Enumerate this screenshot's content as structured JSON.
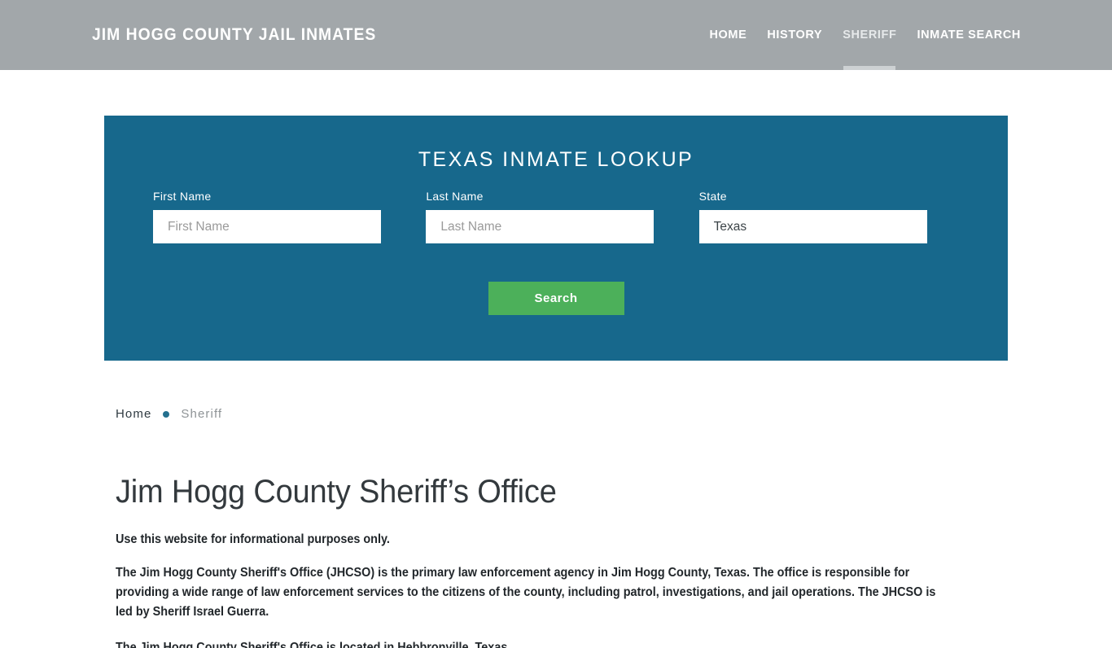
{
  "header": {
    "site_title": "JIM HOGG COUNTY JAIL INMATES",
    "nav": [
      {
        "label": "HOME",
        "name": "nav-item-home",
        "active": false
      },
      {
        "label": "HISTORY",
        "name": "nav-item-history",
        "active": false
      },
      {
        "label": "SHERIFF",
        "name": "nav-item-sheriff",
        "active": true
      },
      {
        "label": "INMATE SEARCH",
        "name": "nav-item-inmate-search",
        "active": false
      }
    ]
  },
  "lookup": {
    "title": "TEXAS INMATE LOOKUP",
    "first_name": {
      "label": "First Name",
      "placeholder": "First Name",
      "value": ""
    },
    "last_name": {
      "label": "Last Name",
      "placeholder": "Last Name",
      "value": ""
    },
    "state": {
      "label": "State",
      "placeholder": "State",
      "value": "Texas"
    },
    "search_label": "Search"
  },
  "breadcrumb": {
    "home": "Home",
    "current": "Sheriff"
  },
  "main": {
    "page_title": "Jim Hogg County Sheriff’s Office",
    "lead": "Use this website for informational purposes only.",
    "paragraph": "The Jim Hogg County Sheriff's Office (JHCSO) is the primary law enforcement agency in Jim Hogg County, Texas. The office is responsible for providing a wide range of law enforcement services to the citizens of the county, including patrol, investigations, and jail operations. The JHCSO is led by Sheriff Israel Guerra.",
    "paragraph_next": "The Jim Hogg County Sheriff's Office is located in Hebbronville, Texas."
  },
  "colors": {
    "header_gray": "#a2a7aa",
    "panel_teal": "#17688c",
    "button_green": "#4cb05a",
    "accent_dot": "#24708f"
  }
}
